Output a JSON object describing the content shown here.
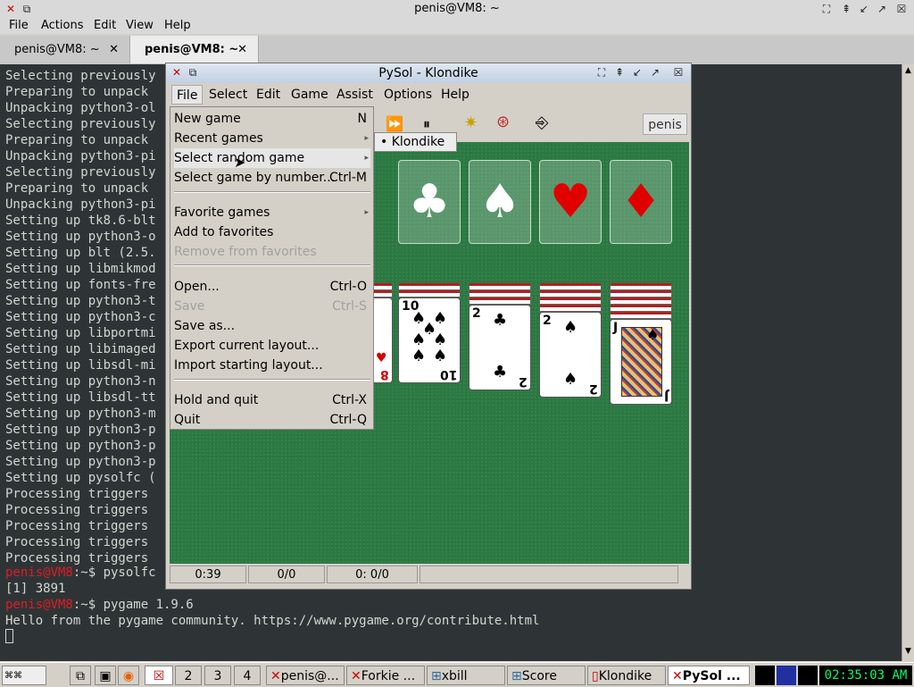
{
  "terminal_window": {
    "title": "penis@VM8: ~",
    "menu": [
      "File",
      "Actions",
      "Edit",
      "View",
      "Help"
    ],
    "tabs": [
      {
        "label": "penis@VM8: ~",
        "active": false
      },
      {
        "label": "penis@VM8: ~",
        "active": true
      }
    ],
    "lines": [
      "Selecting previously",
      "Preparing to unpack",
      "Unpacking python3-ol",
      "Selecting previously",
      "Preparing to unpack",
      "Unpacking python3-pi",
      "Selecting previously",
      "Preparing to unpack",
      "Unpacking python3-pi",
      "Setting up tk8.6-blt",
      "Setting up python3-o",
      "Setting up blt (2.5.",
      "Setting up libmikmod",
      "Setting up fonts-fre",
      "Setting up python3-t",
      "Setting up python3-c",
      "Setting up libportmi",
      "Setting up libimaged",
      "Setting up libsdl-mi",
      "Setting up python3-n",
      "Setting up libsdl-tt",
      "Setting up python3-m",
      "Setting up python3-p",
      "Setting up python3-p",
      "Setting up python3-p",
      "Setting up pysolfc (",
      "Processing triggers",
      "Processing triggers",
      "Processing triggers",
      "Processing triggers",
      "Processing triggers"
    ],
    "prompt_user": "penis@VM8",
    "prompt_path": ":~$ ",
    "command1": "pysolfc",
    "job_line": "[1] 3891",
    "command2": "pygame 1.9.6",
    "hello_line": "Hello from the pygame community. https://www.pygame.org/contribute.html",
    "colors": {
      "bg": "#2e3436",
      "text": "#d3d7cf",
      "prompt": "#e01b24"
    }
  },
  "pysol_window": {
    "title": "PySol - Klondike",
    "menu": [
      "File",
      "Select",
      "Edit",
      "Game",
      "Assist",
      "Options",
      "Help"
    ],
    "player_name": "penis",
    "status": {
      "time": "0:39",
      "moves": "0/0",
      "score": "0: 0/0",
      "extra": ""
    },
    "felt_color": "#2c7a43",
    "foundations": [
      {
        "suit": "club",
        "symbol": "♣"
      },
      {
        "suit": "spade",
        "symbol": "♠"
      },
      {
        "suit": "heart",
        "symbol": "♥"
      },
      {
        "suit": "diamond",
        "symbol": "♦"
      }
    ],
    "visible_cards": [
      {
        "rank": "8",
        "suit": "♥"
      },
      {
        "rank": "10",
        "suit": "♠"
      },
      {
        "rank": "2",
        "suit": "♣"
      },
      {
        "rank": "2",
        "suit": "♠"
      },
      {
        "rank": "J",
        "suit": "♠"
      }
    ]
  },
  "file_menu": {
    "items": [
      {
        "label": "New game",
        "accel": "N",
        "disabled": false
      },
      {
        "label": "Recent games",
        "accel": "",
        "submenu": true
      },
      {
        "label": "Select random game",
        "accel": "",
        "submenu": true,
        "highlighted": true
      },
      {
        "label": "Select game by number...",
        "accel": "Ctrl-M"
      },
      {
        "label": "Favorite games",
        "accel": "",
        "submenu": true
      },
      {
        "label": "Add to favorites",
        "accel": ""
      },
      {
        "label": "Remove from favorites",
        "accel": "",
        "disabled": true
      },
      {
        "label": "Open...",
        "accel": "Ctrl-O"
      },
      {
        "label": "Save",
        "accel": "Ctrl-S",
        "disabled": true
      },
      {
        "label": "Save as...",
        "accel": ""
      },
      {
        "label": "Export current layout...",
        "accel": ""
      },
      {
        "label": "Import starting layout...",
        "accel": ""
      },
      {
        "label": "Hold and quit",
        "accel": "Ctrl-X"
      },
      {
        "label": "Quit",
        "accel": "Ctrl-Q"
      }
    ],
    "submenu_item": "• Klondike"
  },
  "taskbar": {
    "workspaces": [
      "2",
      "3",
      "4"
    ],
    "tasks": [
      "penis@...",
      "Forkie ...",
      "xbill",
      "Score",
      "Klondike",
      "PySol ..."
    ],
    "clock": "02:35:03 AM"
  }
}
